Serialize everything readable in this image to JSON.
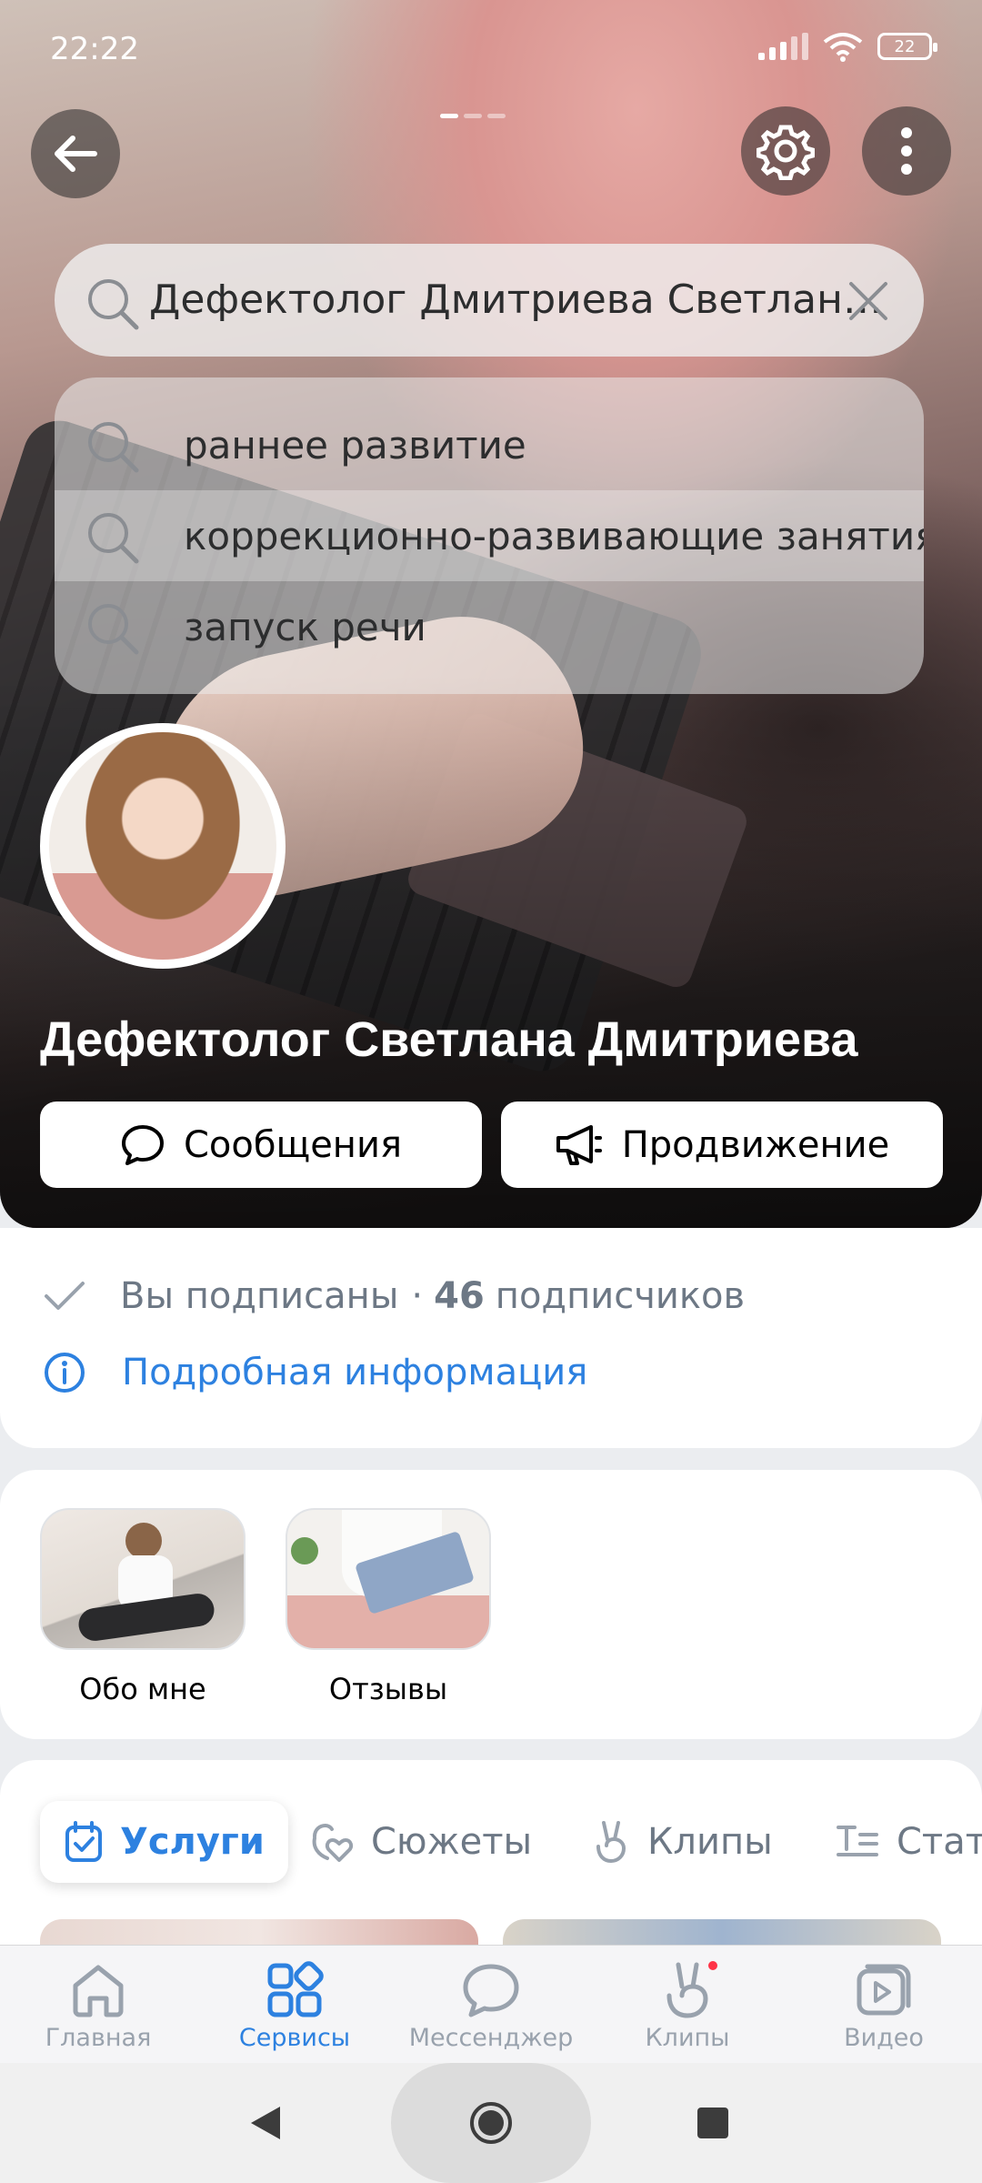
{
  "status_bar": {
    "time": "22:22",
    "battery": "22"
  },
  "search": {
    "query": "Дефектолог Дмитриева Светлана...",
    "suggestions": [
      {
        "label": "раннее  развитие"
      },
      {
        "label": "коррекционно-развивающие занятия"
      },
      {
        "label": "запуск речи"
      }
    ]
  },
  "profile": {
    "name": "Дефектолог Светлана Дмитриева",
    "messages_label": "Сообщения",
    "promotion_label": "Продвижение"
  },
  "info": {
    "subscribed": "Вы подписаны",
    "separator": "·",
    "followers_count": "46",
    "followers_word": "подписчиков",
    "details_link": "Подробная информация"
  },
  "stories": [
    {
      "label": "Обо мне"
    },
    {
      "label": "Отзывы"
    }
  ],
  "tabs": [
    {
      "label": "Услуги",
      "active": true
    },
    {
      "label": "Сюжеты"
    },
    {
      "label": "Клипы"
    },
    {
      "label": "Стат"
    }
  ],
  "bottom_nav": [
    {
      "label": "Главная"
    },
    {
      "label": "Сервисы",
      "active": true
    },
    {
      "label": "Мессенджер"
    },
    {
      "label": "Клипы"
    },
    {
      "label": "Видео"
    }
  ],
  "colors": {
    "accent": "#2d81e0",
    "secondary_text": "#6d7885",
    "badge": "#ff3347"
  }
}
